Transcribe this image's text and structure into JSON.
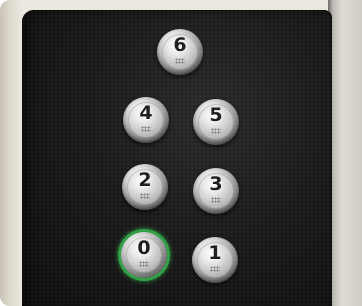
{
  "scene": {
    "panel_color": "#151515",
    "ring_highlight_color": "#2ea043"
  },
  "buttons": [
    {
      "label": "6",
      "lit": false
    },
    {
      "label": "4",
      "lit": false
    },
    {
      "label": "5",
      "lit": false
    },
    {
      "label": "2",
      "lit": false
    },
    {
      "label": "3",
      "lit": false
    },
    {
      "label": "0",
      "lit": true
    },
    {
      "label": "1",
      "lit": false
    }
  ]
}
